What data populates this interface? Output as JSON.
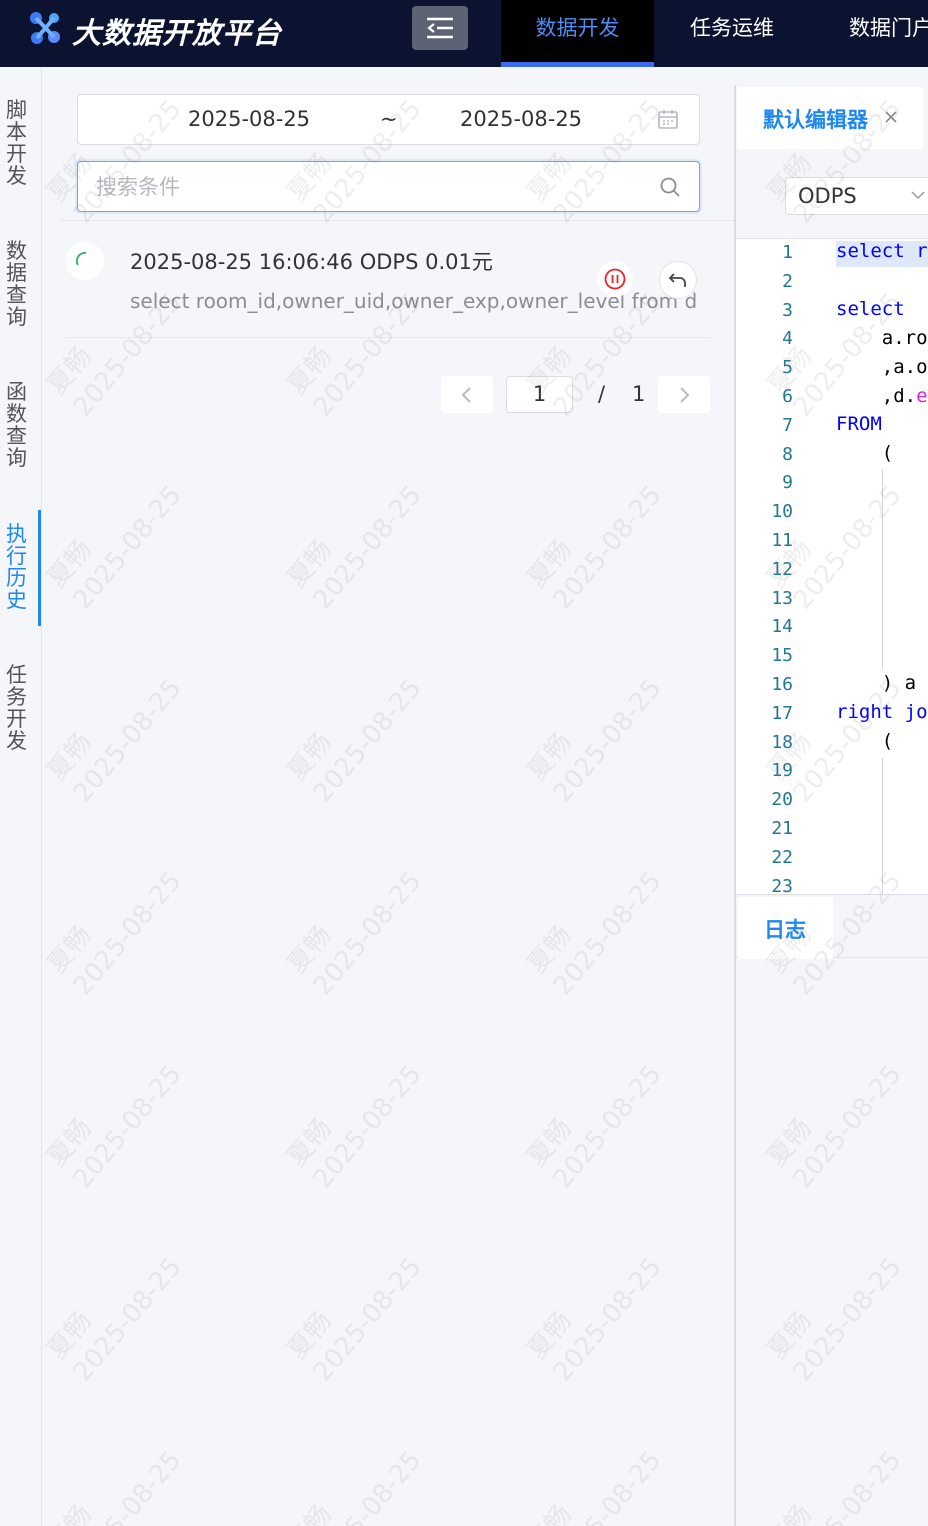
{
  "header": {
    "app_title": "大数据开放平台",
    "logo_icon": "logo-icon",
    "menu_toggle_icon": "menu-fold-icon",
    "nav": [
      {
        "label": "数据开发",
        "active": true
      },
      {
        "label": "任务运维",
        "active": false
      },
      {
        "label": "数据门户",
        "active": false
      }
    ]
  },
  "sidebar": {
    "tabs": [
      {
        "label": "脚本开发",
        "active": false
      },
      {
        "label": "数据查询",
        "active": false
      },
      {
        "label": "函数查询",
        "active": false
      },
      {
        "label": "执行历史",
        "active": true
      },
      {
        "label": "任务开发",
        "active": false
      }
    ]
  },
  "history": {
    "date_start": "2025-08-25",
    "date_separator": "~",
    "date_end": "2025-08-25",
    "search_placeholder": "搜索条件",
    "search_value": "",
    "items": [
      {
        "title": "2025-08-25 16:06:46 ODPS 0.01元",
        "sql": "select room_id,owner_uid,owner_exp,owner_level from d",
        "status": "running"
      }
    ],
    "pager": {
      "current": "1",
      "separator": "/",
      "total": "1"
    }
  },
  "editor": {
    "tab_label": "默认编辑器",
    "engine": "ODPS",
    "line_numbers": [
      "1",
      "2",
      "3",
      "4",
      "5",
      "6",
      "7",
      "8",
      "9",
      "10",
      "11",
      "12",
      "13",
      "14",
      "15",
      "16",
      "17",
      "18",
      "19",
      "20",
      "21",
      "22",
      "23"
    ],
    "code": {
      "l1": "select r",
      "l3": "select",
      "l4": "    a.ro",
      "l5a": "    ,a.o",
      "l6a": "    ,d.",
      "l6b": "e",
      "l7": "FROM",
      "l8": "    (",
      "l16": "    ) a",
      "l17a": "right",
      "l17b": " jo",
      "l18": "    ("
    },
    "log_tab": "日志"
  },
  "watermark": {
    "name": "夏畅",
    "date": "2025-08-25"
  },
  "colors": {
    "accent": "#1e88f0",
    "header_bg": "#0c1330",
    "nav_active": "#4d8bf5"
  }
}
